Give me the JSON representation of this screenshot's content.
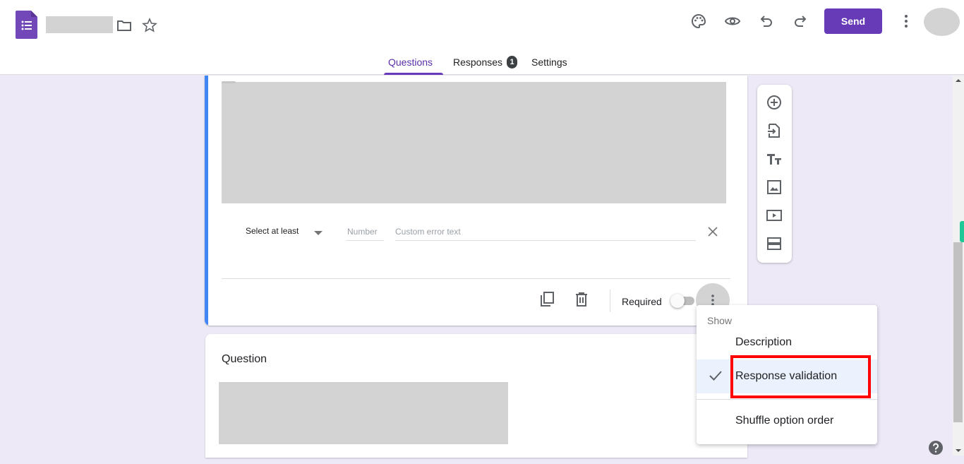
{
  "header": {
    "app_icon": "google-forms-icon",
    "title": "",
    "icons": [
      "folder-icon",
      "star-icon",
      "palette-icon",
      "eye-icon",
      "undo-icon",
      "redo-icon",
      "more-vert-icon"
    ],
    "send_label": "Send",
    "brand_color": "#673ab7"
  },
  "tabs": [
    {
      "label": "Questions",
      "active": true
    },
    {
      "label": "Responses",
      "badge": "1"
    },
    {
      "label": "Settings"
    }
  ],
  "question_card": {
    "accent_color": "#4285f4",
    "validation": {
      "type": "Select at least",
      "number_placeholder": "Number",
      "error_placeholder": "Custom error text"
    },
    "required_label": "Required",
    "required_on": false
  },
  "next_card": {
    "title": "Question"
  },
  "side_toolbar": [
    "add-question-icon",
    "import-questions-icon",
    "add-title-icon",
    "add-image-icon",
    "add-video-icon",
    "add-section-icon"
  ],
  "menu": {
    "header": "Show",
    "items": [
      {
        "label": "Description",
        "checked": false
      },
      {
        "label": "Response validation",
        "checked": true
      },
      {
        "label": "Shuffle option order",
        "checked": false
      }
    ]
  }
}
